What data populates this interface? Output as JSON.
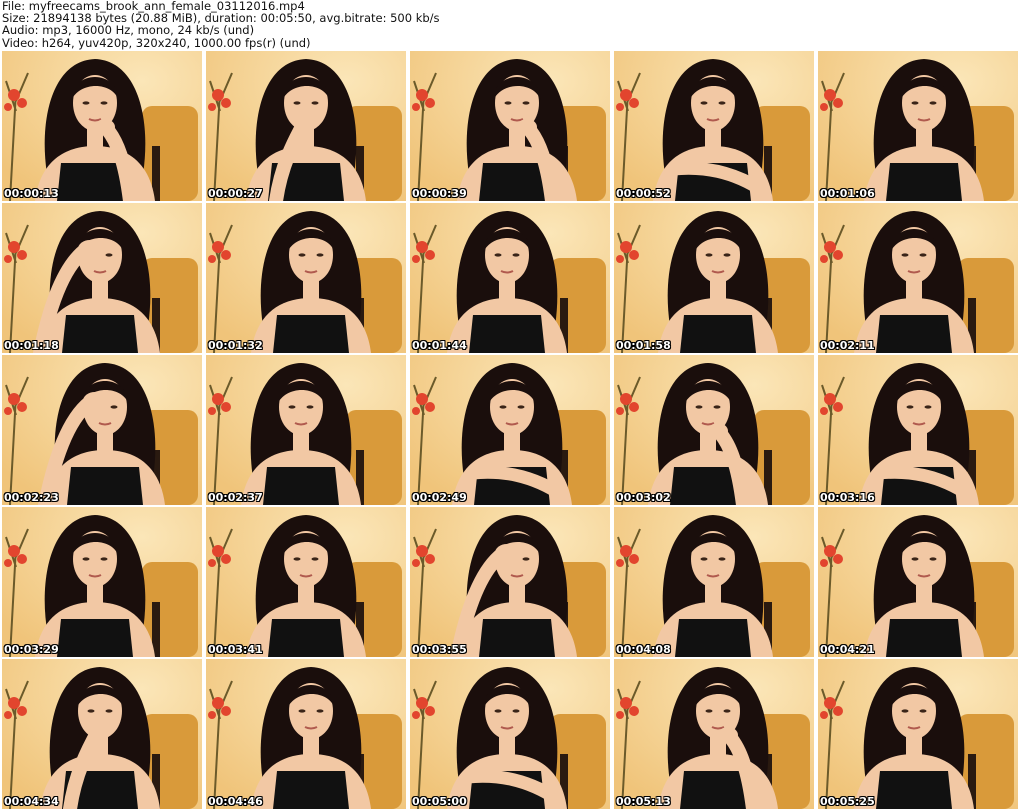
{
  "header": {
    "file_line": "File: myfreecams_brook_ann_female_03112016.mp4",
    "size_line": "Size: 21894138 bytes (20.88 MiB), duration: 00:05:50, avg.bitrate: 500 kb/s",
    "audio_line": "Audio: mp3, 16000 Hz, mono, 24 kb/s (und)",
    "video_line": "Video: h264, yuv420p, 320x240, 1000.00 fps(r) (und)"
  },
  "thumbnails": [
    {
      "timestamp": "00:00:13",
      "pose": "chin"
    },
    {
      "timestamp": "00:00:27",
      "pose": "mouth"
    },
    {
      "timestamp": "00:00:39",
      "pose": "chin"
    },
    {
      "timestamp": "00:00:52",
      "pose": "arm"
    },
    {
      "timestamp": "00:01:06",
      "pose": "plain"
    },
    {
      "timestamp": "00:01:18",
      "pose": "face"
    },
    {
      "timestamp": "00:01:32",
      "pose": "plain"
    },
    {
      "timestamp": "00:01:44",
      "pose": "plain"
    },
    {
      "timestamp": "00:01:58",
      "pose": "plain"
    },
    {
      "timestamp": "00:02:11",
      "pose": "plain"
    },
    {
      "timestamp": "00:02:23",
      "pose": "face"
    },
    {
      "timestamp": "00:02:37",
      "pose": "plain"
    },
    {
      "timestamp": "00:02:49",
      "pose": "arm"
    },
    {
      "timestamp": "00:03:02",
      "pose": "chin"
    },
    {
      "timestamp": "00:03:16",
      "pose": "arm"
    },
    {
      "timestamp": "00:03:29",
      "pose": "plain"
    },
    {
      "timestamp": "00:03:41",
      "pose": "plain"
    },
    {
      "timestamp": "00:03:55",
      "pose": "face"
    },
    {
      "timestamp": "00:04:08",
      "pose": "plain"
    },
    {
      "timestamp": "00:04:21",
      "pose": "plain"
    },
    {
      "timestamp": "00:04:34",
      "pose": "mouth"
    },
    {
      "timestamp": "00:04:46",
      "pose": "plain"
    },
    {
      "timestamp": "00:05:00",
      "pose": "arm"
    },
    {
      "timestamp": "00:05:13",
      "pose": "chin"
    },
    {
      "timestamp": "00:05:25",
      "pose": "plain"
    }
  ],
  "colors": {
    "page_background": "#ffffff",
    "wall": "#f0c47a",
    "wall_light": "#fbe6b8",
    "chair": "#d99a3a",
    "hair": "#1a0e0c",
    "skin": "#f2c8a4",
    "dress": "#111111",
    "flowers": "#e2452e",
    "timestamp_text": "#ffffff"
  }
}
